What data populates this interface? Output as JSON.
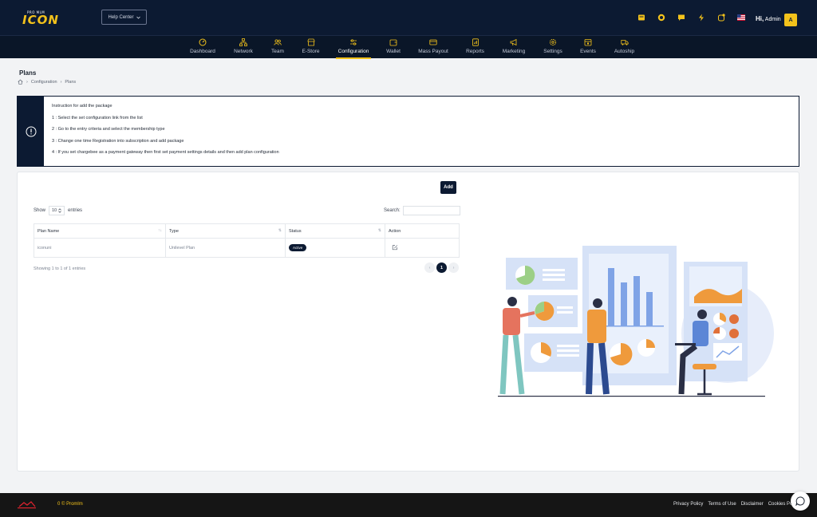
{
  "header": {
    "logo_small": "PRO MLM",
    "logo_big": "ICON",
    "help_center": "Help Center",
    "greeting_prefix": "Hi,",
    "user_name": "Admin",
    "avatar_letter": "A",
    "icons": [
      "card-icon",
      "ticket-icon",
      "chat-icon",
      "bolt-icon",
      "notification-icon",
      "us-flag-icon"
    ]
  },
  "nav": {
    "items": [
      {
        "label": "Dashboard",
        "icon": "dashboard-icon"
      },
      {
        "label": "Network",
        "icon": "network-icon"
      },
      {
        "label": "Team",
        "icon": "team-icon"
      },
      {
        "label": "E-Store",
        "icon": "store-icon"
      },
      {
        "label": "Configuration",
        "icon": "configuration-icon",
        "active": true
      },
      {
        "label": "Wallet",
        "icon": "wallet-icon"
      },
      {
        "label": "Mass Payout",
        "icon": "payout-icon"
      },
      {
        "label": "Reports",
        "icon": "reports-icon"
      },
      {
        "label": "Marketing",
        "icon": "marketing-icon"
      },
      {
        "label": "Settings",
        "icon": "settings-icon"
      },
      {
        "label": "Events",
        "icon": "events-icon"
      },
      {
        "label": "Autoship",
        "icon": "autoship-icon"
      }
    ]
  },
  "page": {
    "title": "Plans",
    "breadcrumb": [
      "Configuration",
      "Plans"
    ]
  },
  "instructions": {
    "heading": "Instruction for add the package",
    "steps": [
      "1 : Select the set configuration link from the list",
      "2 : Go to the entry criteria and select the membership type",
      "3 : Change one time Registration into subscription and add package",
      "4 : If you set chargebee as a payment gateway then first set payment settings details and then add plan configuration"
    ]
  },
  "table": {
    "add_label": "Add",
    "show_label": "Show",
    "show_value": "10",
    "entries_label": "entries",
    "search_label": "Search:",
    "columns": [
      "Plan Name",
      "Type",
      "Status",
      "Action"
    ],
    "rows": [
      {
        "plan_name": "iconuni",
        "type": "Unilevel Plan",
        "status": "Active"
      }
    ],
    "info": "Showing 1 to 1 of 1 entries",
    "current_page": "1"
  },
  "footer": {
    "copyright": "0 © Promlm",
    "links": [
      "Privacy Policy",
      "Terms of Use",
      "Disclaimer",
      "Cookies Po"
    ]
  },
  "colors": {
    "navy": "#0c1a32",
    "accent": "#f3c21b",
    "footer": "#151515"
  }
}
